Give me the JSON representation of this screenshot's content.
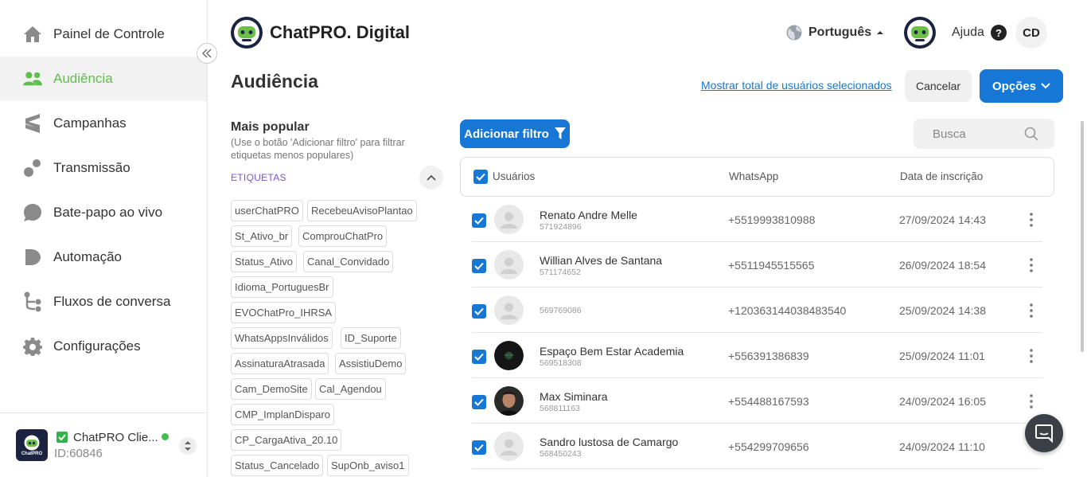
{
  "colors": {
    "primary": "#1677d6",
    "active_green": "#5fbf4b",
    "tag_label": "#7a56c6"
  },
  "sidebar": {
    "items": [
      {
        "label": "Painel de Controle",
        "icon": "home-icon"
      },
      {
        "label": "Audiência",
        "icon": "people-icon",
        "active": true
      },
      {
        "label": "Campanhas",
        "icon": "campaign-icon"
      },
      {
        "label": "Transmissão",
        "icon": "broadcast-icon"
      },
      {
        "label": "Bate-papo ao vivo",
        "icon": "chat-bubble-icon"
      },
      {
        "label": "Automação",
        "icon": "automation-icon"
      },
      {
        "label": "Fluxos de conversa",
        "icon": "flow-icon"
      },
      {
        "label": "Configurações",
        "icon": "gear-icon"
      }
    ],
    "account": {
      "name": "ChatPRO Clie...",
      "id": "ID:60846",
      "logo_text": "ChatPRO"
    }
  },
  "header": {
    "brand": "ChatPRO. Digital",
    "language": "Português",
    "help": "Ajuda",
    "user_initials": "CD"
  },
  "page": {
    "title": "Audiência",
    "show_total_link": "Mostrar total de usuários selecionados",
    "cancel": "Cancelar",
    "options": "Opções"
  },
  "filters": {
    "title": "Mais popular",
    "hint": "(Use o botão 'Adicionar filtro' para filtrar etiquetas menos populares)",
    "tags_label": "ETIQUETAS",
    "tags": [
      "userChatPRO",
      "RecebeuAvisoPlantao",
      "St_Ativo_br",
      "ComprouChatPro",
      "Status_Ativo",
      "Canal_Convidado",
      "Idioma_PortuguesBr",
      "EVOChatPro_IHRSA",
      "WhatsAppsInválidos",
      "ID_Suporte",
      "AssinaturaAtrasada",
      "AssistiuDemo",
      "Cam_DemoSite",
      "Cal_Agendou",
      "CMP_ImplanDisparo",
      "CP_CargaAtiva_20.10",
      "Status_Cancelado",
      "SupOnb_aviso1"
    ]
  },
  "table": {
    "add_filter": "Adicionar filtro",
    "search_placeholder": "Busca",
    "columns": {
      "users": "Usuários",
      "whatsapp": "WhatsApp",
      "date": "Data de inscrição"
    },
    "rows": [
      {
        "name": "Renato Andre Melle",
        "id": "571924896",
        "phone": "+5519993810988",
        "date": "27/09/2024 14:43",
        "avatar": "default"
      },
      {
        "name": "Willian Alves de Santana",
        "id": "571174652",
        "phone": "+5511945515565",
        "date": "26/09/2024 18:54",
        "avatar": "default"
      },
      {
        "name": "",
        "id": "569769086",
        "phone": "+120363144038483540",
        "date": "25/09/2024 14:38",
        "avatar": "default"
      },
      {
        "name": "Espaço Bem Estar Academia",
        "id": "569518308",
        "phone": "+556391386839",
        "date": "25/09/2024 11:01",
        "avatar": "dark"
      },
      {
        "name": "Max Siminara",
        "id": "568811163",
        "phone": "+554488167593",
        "date": "24/09/2024 16:05",
        "avatar": "photo"
      },
      {
        "name": "Sandro lustosa de Camargo",
        "id": "568450243",
        "phone": "+554299709656",
        "date": "24/09/2024 11:10",
        "avatar": "default"
      }
    ]
  }
}
